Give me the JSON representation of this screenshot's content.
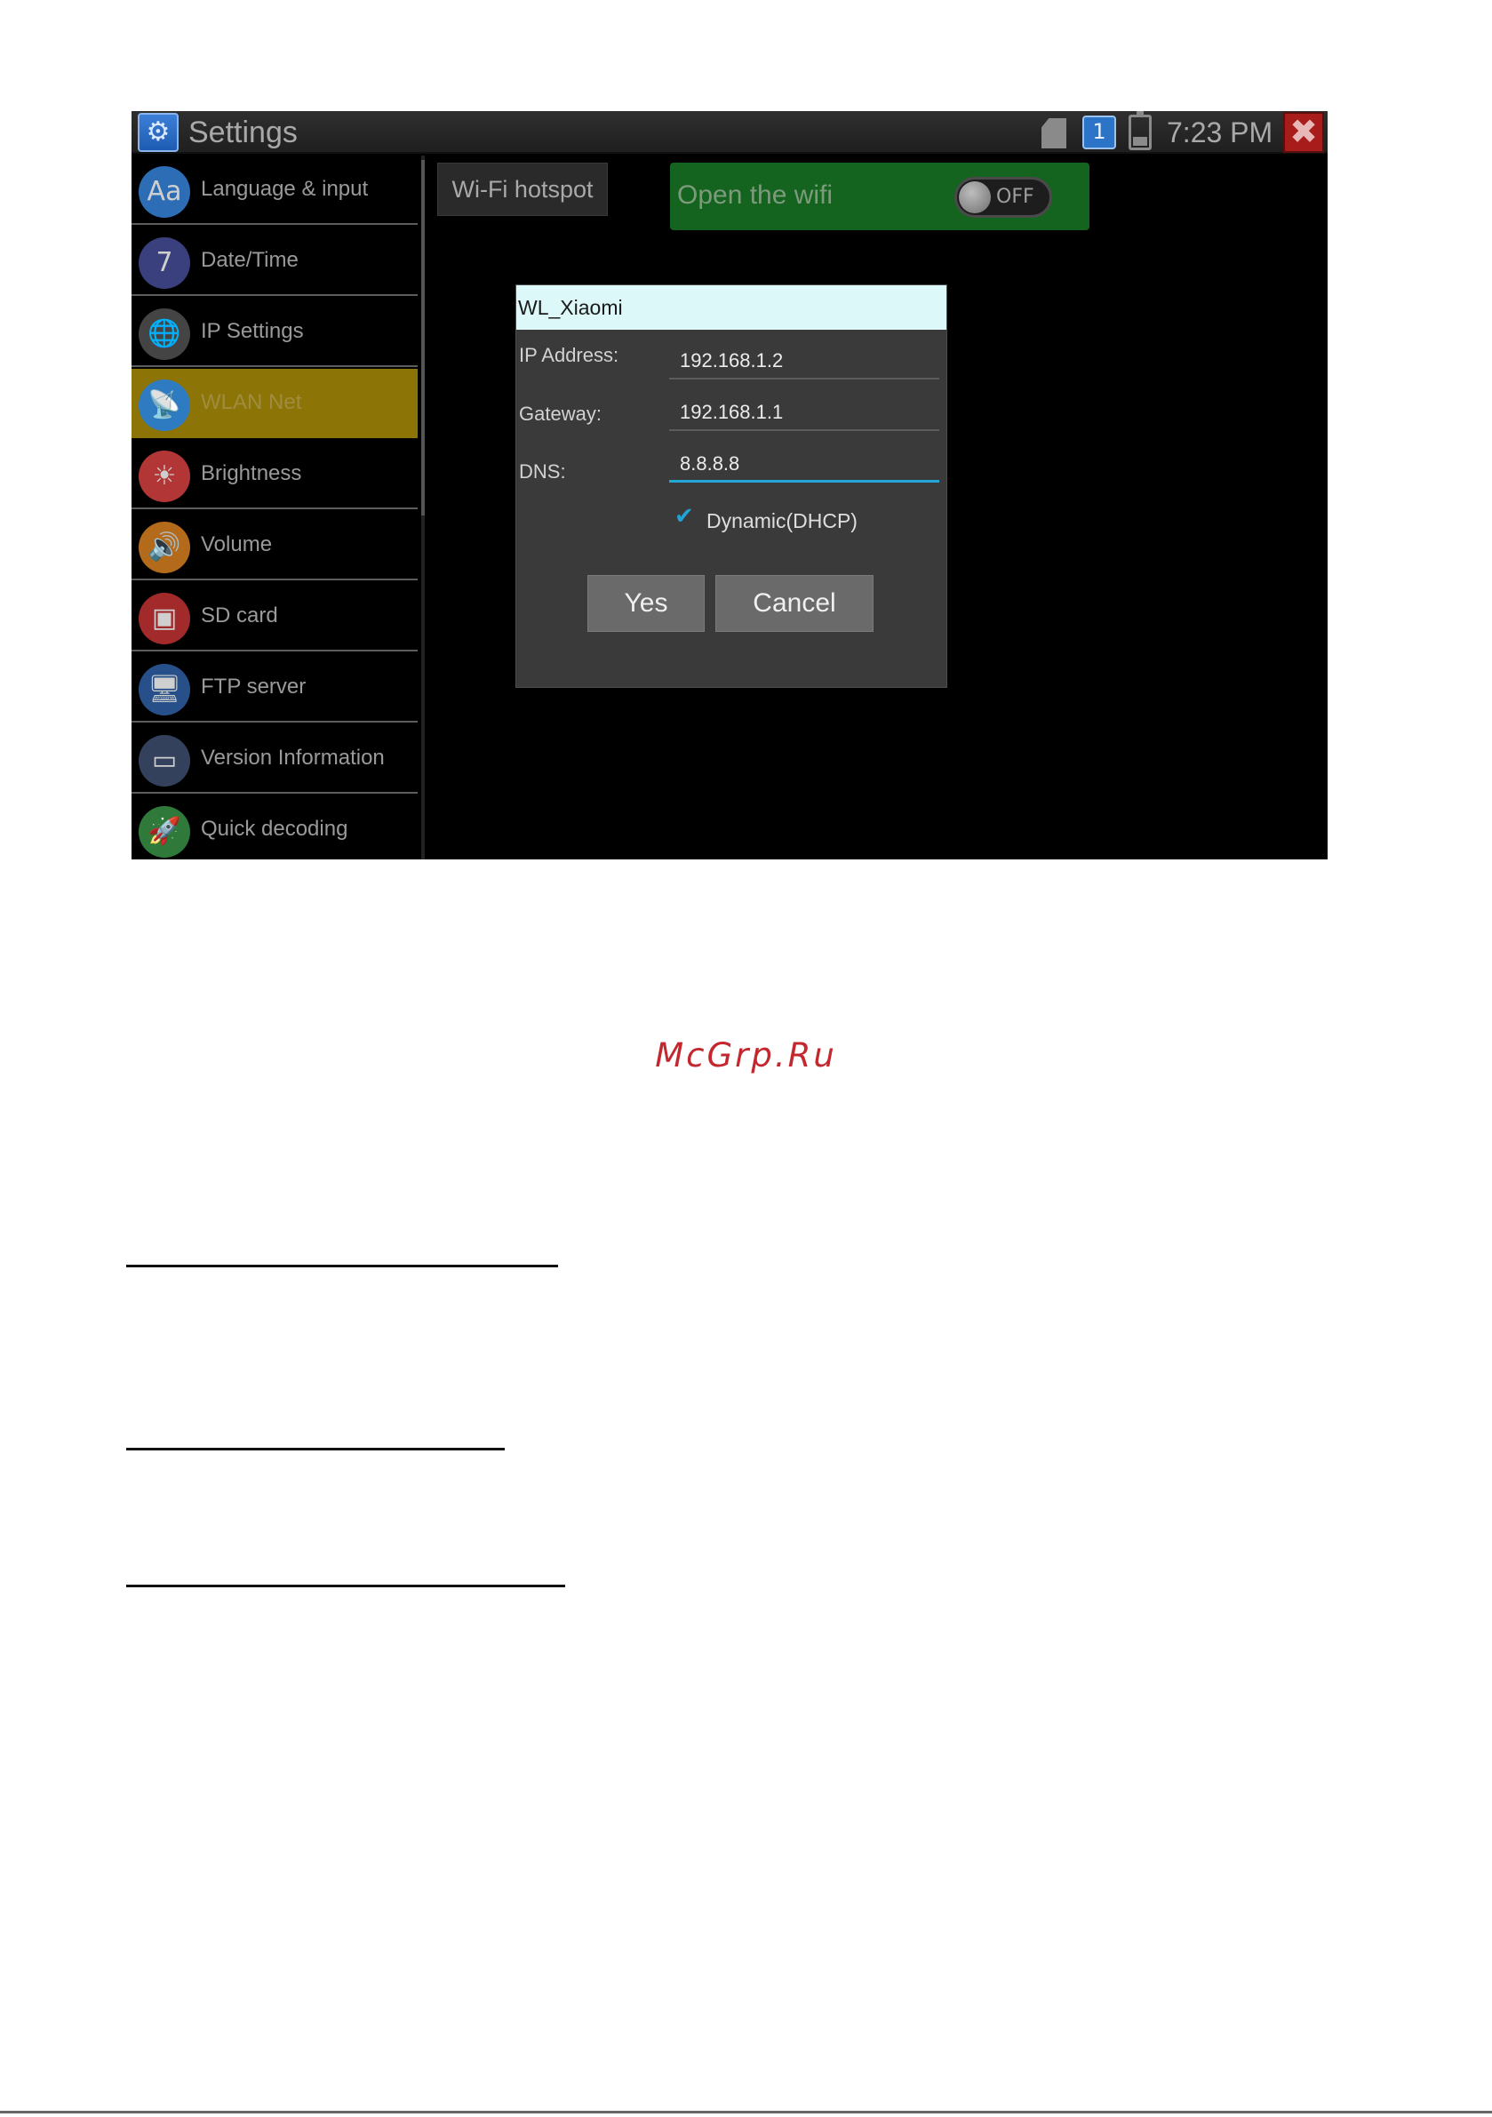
{
  "topbar": {
    "app_icon_glyph": "⚙",
    "title": "Settings",
    "notification_icon_text": "1",
    "time": "7:23 PM",
    "close_glyph": "✖"
  },
  "sidebar": {
    "items": [
      {
        "label": "Language & input",
        "icon": "language-icon",
        "glyph": "Aa",
        "color": "#2d6db5",
        "selected": false
      },
      {
        "label": "Date/Time",
        "icon": "calendar-icon",
        "glyph": "7",
        "color": "#3a3f7d",
        "selected": false
      },
      {
        "label": "IP Settings",
        "icon": "globe-icon",
        "glyph": "🌐",
        "color": "#444444",
        "selected": false
      },
      {
        "label": "WLAN Net",
        "icon": "wifi-antenna-icon",
        "glyph": "📡",
        "color": "#2e7bc2",
        "selected": true
      },
      {
        "label": "Brightness",
        "icon": "brightness-icon",
        "glyph": "☀",
        "color": "#b23636",
        "selected": false
      },
      {
        "label": "Volume",
        "icon": "volume-icon",
        "glyph": "🔊",
        "color": "#b36a1b",
        "selected": false
      },
      {
        "label": "SD card",
        "icon": "sd-card-icon",
        "glyph": "▣",
        "color": "#a22a2a",
        "selected": false
      },
      {
        "label": "FTP server",
        "icon": "ftp-server-icon",
        "glyph": "🖥",
        "color": "#27508a",
        "selected": false
      },
      {
        "label": "Version Information",
        "icon": "version-info-icon",
        "glyph": "▭",
        "color": "#33415c",
        "selected": false
      },
      {
        "label": "Quick decoding",
        "icon": "rocket-icon",
        "glyph": "🚀",
        "color": "#2f7a3a",
        "selected": false
      }
    ]
  },
  "main": {
    "hotspot_label": "Wi-Fi hotspot",
    "wifi_label": "Open the wifi",
    "wifi_toggle_text": "OFF"
  },
  "dialog": {
    "title": "WL_Xiaomi",
    "ip_label": "IP Address:",
    "ip_value": "192.168.1.2",
    "gateway_label": "Gateway:",
    "gateway_value": "192.168.1.1",
    "dns_label": "DNS:",
    "dns_value": "8.8.8.8",
    "dhcp_checked": true,
    "dhcp_label": "Dynamic(DHCP)",
    "yes_label": "Yes",
    "cancel_label": "Cancel"
  },
  "page": {
    "watermark": "McGrp.Ru"
  }
}
